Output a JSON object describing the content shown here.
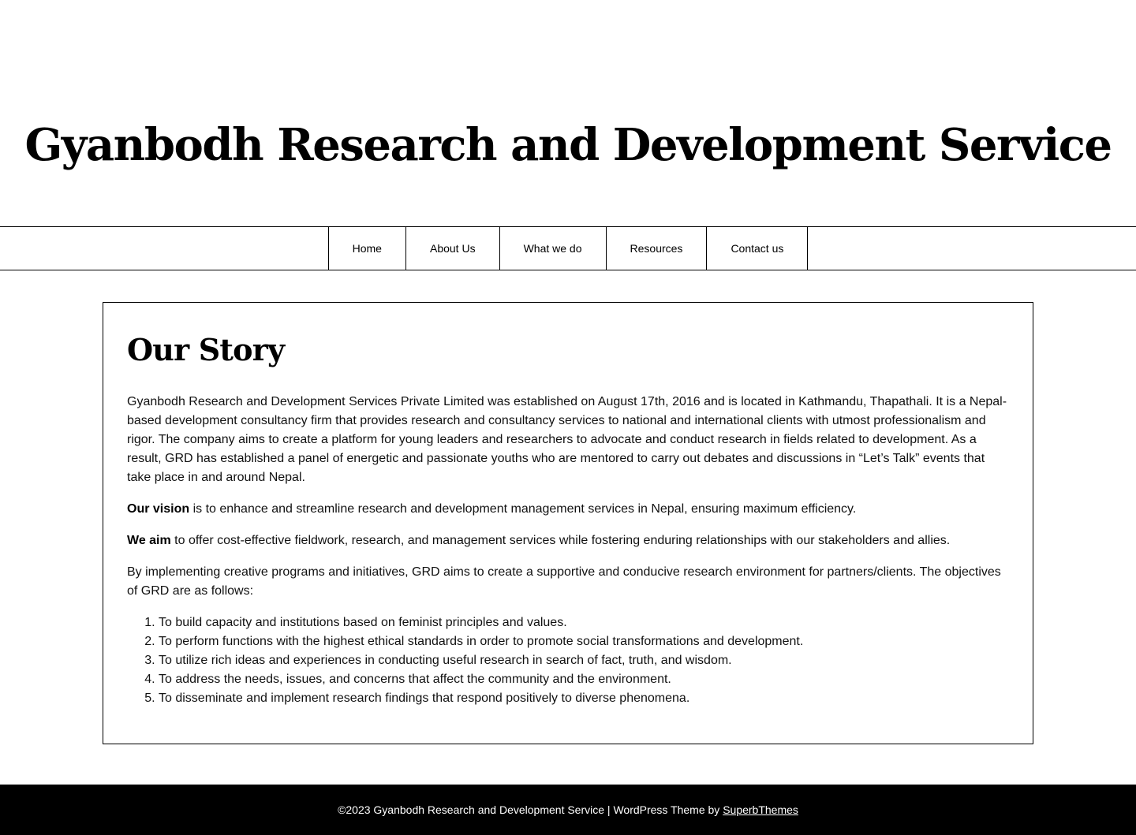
{
  "header": {
    "site_title": "Gyanbodh Research and Development Service"
  },
  "nav": {
    "items": [
      {
        "label": "Home"
      },
      {
        "label": "About Us"
      },
      {
        "label": "What we do"
      },
      {
        "label": "Resources"
      },
      {
        "label": "Contact us"
      }
    ]
  },
  "content": {
    "title": "Our Story",
    "intro": "Gyanbodh Research and Development Services Private Limited was established on August 17th, 2016 and is located in Kathmandu, Thapathali. It is a Nepal-based development consultancy firm that provides research and consultancy services to national and international clients with utmost professionalism and rigor. The company aims to create a platform for young leaders and researchers to advocate and conduct research in fields related to development. As a result, GRD has established a panel of energetic and passionate youths who are mentored to carry out debates and discussions in “Let’s Talk” events that take place in and around Nepal.",
    "vision_label": "Our vision",
    "vision_text": " is to enhance and streamline research and development management services in Nepal, ensuring maximum efficiency.",
    "aim_label": "We aim",
    "aim_text": " to offer cost-effective fieldwork, research, and management services while fostering enduring relationships with our stakeholders and allies.",
    "objectives_intro": "By implementing creative programs and initiatives, GRD aims to create a supportive and conducive research environment for partners/clients. The objectives of GRD are as follows:",
    "objectives": [
      "To build capacity and institutions based on feminist principles and values.",
      "To perform functions with the highest ethical standards in order to promote social transformations and development.",
      "To utilize rich ideas and experiences in conducting useful research in search of fact, truth, and wisdom.",
      "To address the needs, issues, and concerns that affect the community and the environment.",
      "To disseminate and implement research findings that respond positively to diverse phenomena."
    ]
  },
  "footer": {
    "copyright": "©2023 Gyanbodh Research and Development Service | WordPress Theme by ",
    "theme_link": "SuperbThemes"
  }
}
